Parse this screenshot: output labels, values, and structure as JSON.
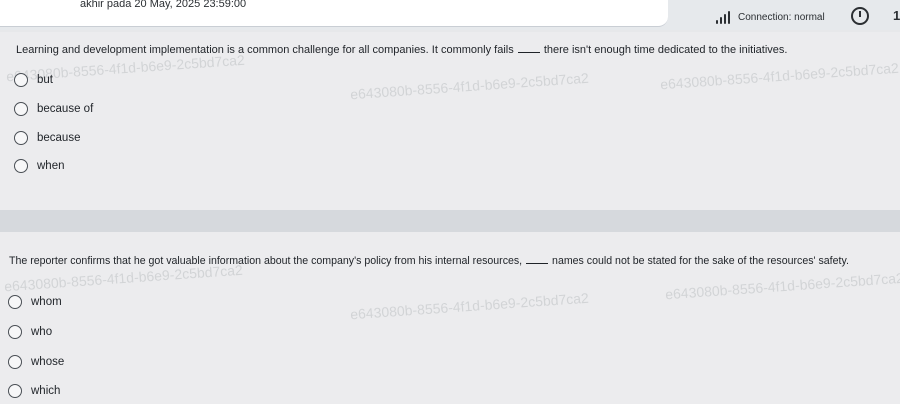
{
  "header": {
    "deadline_text": "akhir pada 20 May, 2025 23:59:00",
    "connection_label": "Connection: normal",
    "page_indicator": "1",
    "watermark_id": "e643080b-8556-4f1d-b6e9-2c5bd7ca2"
  },
  "questions": [
    {
      "text_before": "Learning and development implementation is a common challenge for all companies. It commonly fails",
      "text_after": "there isn't enough time dedicated to the initiatives.",
      "options": [
        {
          "label": "but"
        },
        {
          "label": "because of"
        },
        {
          "label": "because"
        },
        {
          "label": "when"
        }
      ]
    },
    {
      "text_before": "The reporter confirms that he got valuable information about the company's policy from his internal resources,",
      "text_after": "names could not be stated for the sake of the resources' safety.",
      "options": [
        {
          "label": "whom"
        },
        {
          "label": "who"
        },
        {
          "label": "whose"
        },
        {
          "label": "which"
        }
      ]
    }
  ]
}
